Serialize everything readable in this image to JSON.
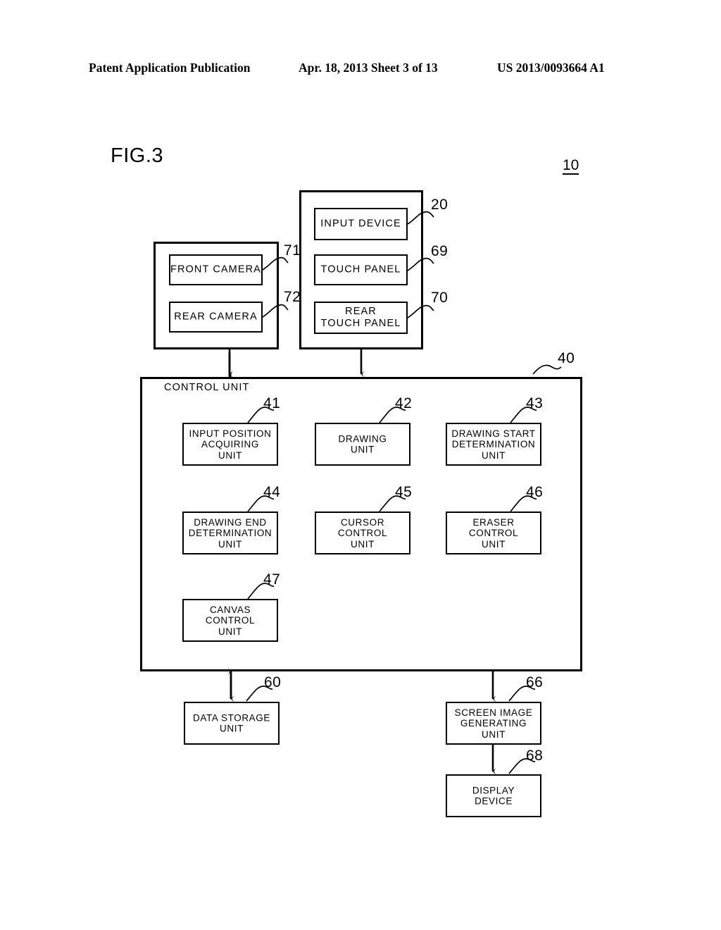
{
  "page_header": {
    "left": "Patent Application Publication",
    "middle": "Apr. 18, 2013  Sheet 3 of 13",
    "right": "US 2013/0093664 A1"
  },
  "figure": {
    "label": "FIG.3",
    "system_ref": "10"
  },
  "camera_group": {
    "ref_front": "71",
    "ref_rear": "72",
    "boxes": [
      {
        "label": "FRONT CAMERA",
        "ref": "71"
      },
      {
        "label": "REAR CAMERA",
        "ref": "72"
      }
    ]
  },
  "input_group": {
    "boxes": [
      {
        "label": "INPUT DEVICE",
        "ref": "20"
      },
      {
        "label": "TOUCH PANEL",
        "ref": "69"
      },
      {
        "label": "REAR\nTOUCH PANEL",
        "ref": "70"
      }
    ]
  },
  "control_unit": {
    "title": "CONTROL UNIT",
    "ref": "40",
    "units": [
      {
        "label": "INPUT POSITION\nACQUIRING\nUNIT",
        "ref": "41"
      },
      {
        "label": "DRAWING\nUNIT",
        "ref": "42"
      },
      {
        "label": "DRAWING START\nDETERMINATION\nUNIT",
        "ref": "43"
      },
      {
        "label": "DRAWING END\nDETERMINATION\nUNIT",
        "ref": "44"
      },
      {
        "label": "CURSOR\nCONTROL\nUNIT",
        "ref": "45"
      },
      {
        "label": "ERASER\nCONTROL\nUNIT",
        "ref": "46"
      },
      {
        "label": "CANVAS\nCONTROL\nUNIT",
        "ref": "47"
      }
    ]
  },
  "bottom": {
    "storage": {
      "label": "DATA STORAGE\nUNIT",
      "ref": "60"
    },
    "screen_image": {
      "label": "SCREEN IMAGE\nGENERATING\nUNIT",
      "ref": "66"
    },
    "display": {
      "label": "DISPLAY\nDEVICE",
      "ref": "68"
    }
  },
  "colors": {
    "line": "#000000",
    "background": "#ffffff"
  }
}
